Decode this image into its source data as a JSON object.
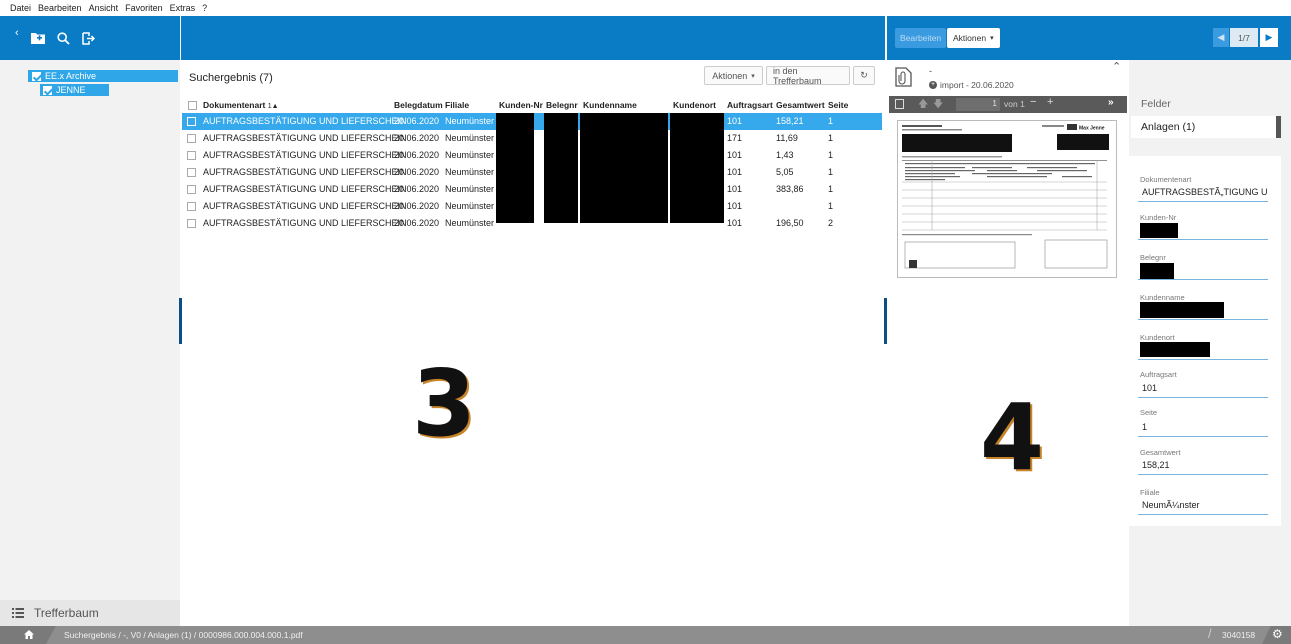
{
  "menu": [
    "Datei",
    "Bearbeiten",
    "Ansicht",
    "Favoriten",
    "Extras",
    "?"
  ],
  "left": {
    "tree": [
      {
        "label": "EE.x Archive"
      },
      {
        "label": "JENNE"
      }
    ],
    "bottom_tab": "Trefferbaum"
  },
  "center": {
    "title": "Suchergebnis (7)",
    "actions_button": "Aktionen",
    "tree_button": "in den Trefferbaum",
    "columns": [
      "Dokumentenart",
      "Belegdatum",
      "Filiale",
      "Kunden-Nr",
      "Belegnr",
      "Kundenname",
      "Kundenort",
      "Auftragsart",
      "Gesamtwert",
      "Seite"
    ],
    "sort_indicator": "1",
    "rows": [
      {
        "art": "AUFTRAGSBESTÄTIGUNG UND LIEFERSCHEIN",
        "datum": "20.06.2020",
        "filiale": "Neumünster",
        "auftragsart": "101",
        "gesamtwert": "158,21",
        "seite": "1"
      },
      {
        "art": "AUFTRAGSBESTÄTIGUNG UND LIEFERSCHEIN",
        "datum": "20.06.2020",
        "filiale": "Neumünster",
        "auftragsart": "171",
        "gesamtwert": "11,69",
        "seite": "1"
      },
      {
        "art": "AUFTRAGSBESTÄTIGUNG UND LIEFERSCHEIN",
        "datum": "20.06.2020",
        "filiale": "Neumünster",
        "auftragsart": "101",
        "gesamtwert": "1,43",
        "seite": "1"
      },
      {
        "art": "AUFTRAGSBESTÄTIGUNG UND LIEFERSCHEIN",
        "datum": "20.06.2020",
        "filiale": "Neumünster",
        "auftragsart": "101",
        "gesamtwert": "5,05",
        "seite": "1"
      },
      {
        "art": "AUFTRAGSBESTÄTIGUNG UND LIEFERSCHEIN",
        "datum": "20.06.2020",
        "filiale": "Neumünster",
        "auftragsart": "101",
        "gesamtwert": "383,86",
        "seite": "1"
      },
      {
        "art": "AUFTRAGSBESTÄTIGUNG UND LIEFERSCHEIN",
        "datum": "20.06.2020",
        "filiale": "Neumünster",
        "auftragsart": "101",
        "gesamtwert": "",
        "seite": "1"
      },
      {
        "art": "AUFTRAGSBESTÄTIGUNG UND LIEFERSCHEIN",
        "datum": "20.06.2020",
        "filiale": "Neumünster",
        "auftragsart": "101",
        "gesamtwert": "196,50",
        "seite": "2"
      }
    ],
    "overlay_number": "3"
  },
  "right": {
    "edit_button": "Bearbeiten",
    "actions_button": "Aktionen",
    "pager": "1/7",
    "doc_dash": "-",
    "doc_info": "import - 20.06.2020",
    "page_input": "1",
    "page_of": "von 1",
    "tab_fields": "Felder",
    "tab_attachments": "Anlagen (1)",
    "fields": [
      {
        "label": "Dokumentenart",
        "value": "AUFTRAGSBESTÃ„TIGUNG UN"
      },
      {
        "label": "Kunden-Nr",
        "value": ""
      },
      {
        "label": "Belegnr",
        "value": ""
      },
      {
        "label": "Kundenname",
        "value": ""
      },
      {
        "label": "Kundenort",
        "value": ""
      },
      {
        "label": "Auftragsart",
        "value": "101"
      },
      {
        "label": "Seite",
        "value": "1"
      },
      {
        "label": "Gesamtwert",
        "value": "158,21"
      },
      {
        "label": "Filiale",
        "value": "NeumÃ¼nster"
      }
    ],
    "overlay_number": "4",
    "preview_brand": "Max Jenne"
  },
  "status": {
    "breadcrumb": "Suchergebnis / -, V0 / Anlagen (1) / 0000986.000.004.000.1.pdf",
    "counter": "3040158"
  },
  "colors": {
    "accent": "#0a7bc5",
    "selection": "#36a9ec"
  }
}
